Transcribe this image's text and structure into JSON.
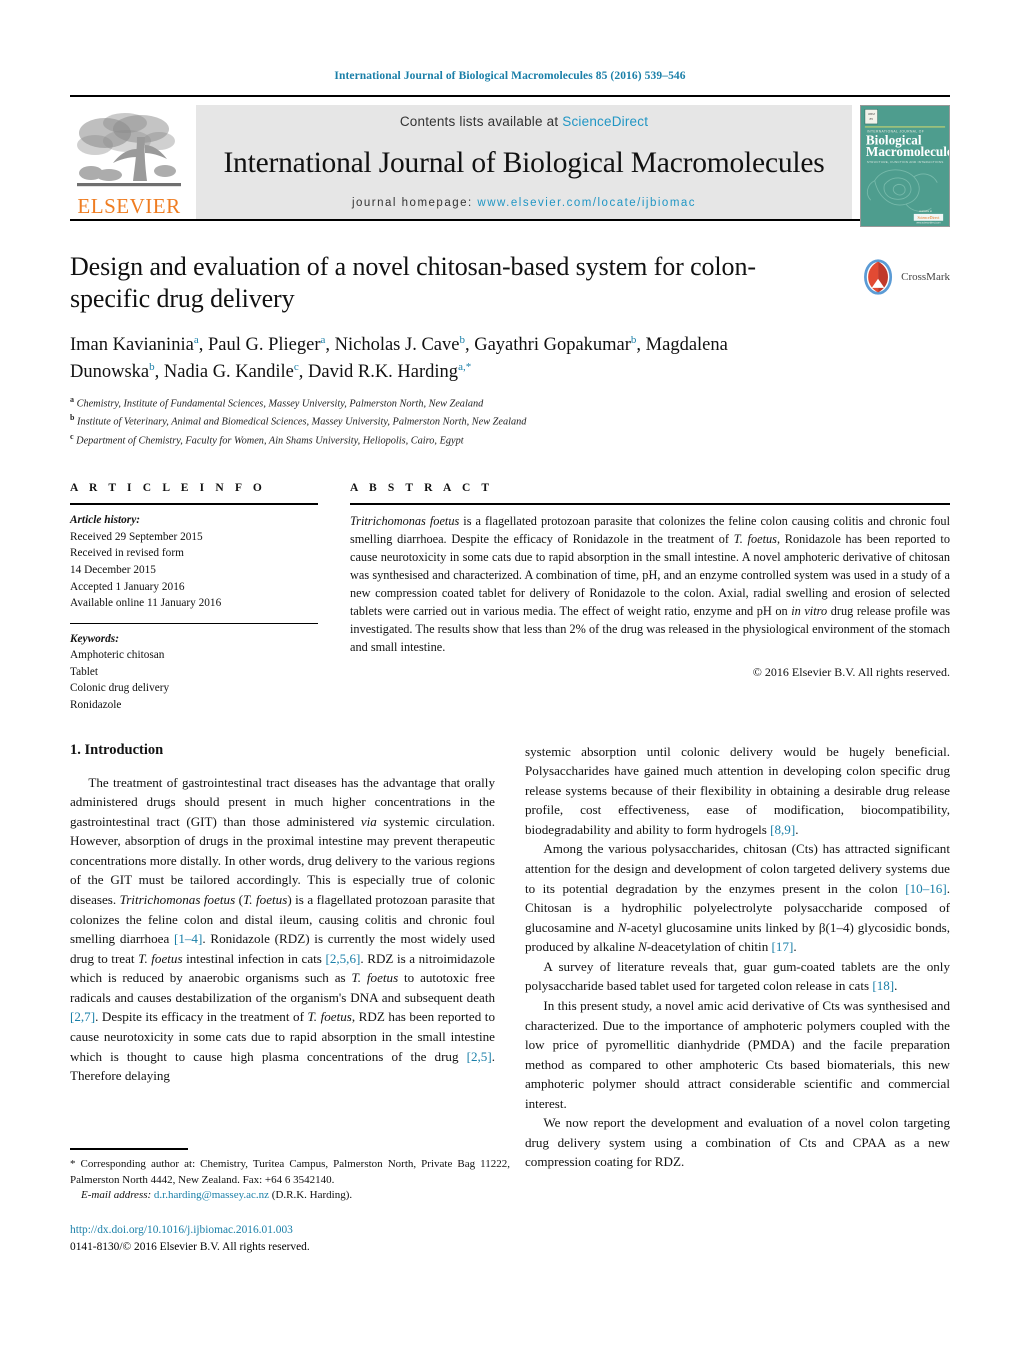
{
  "running_head": "International Journal of Biological Macromolecules 85 (2016) 539–546",
  "masthead": {
    "contents_prefix": "Contents lists available at",
    "sciencedirect": "ScienceDirect",
    "journal_name": "International Journal of Biological Macromolecules",
    "homepage_label": "journal homepage:",
    "homepage_url": "www.elsevier.com/locate/ijbiomac",
    "publisher": "ELSEVIER",
    "cover": {
      "top_line": "INTERNATIONAL JOURNAL OF",
      "title_line_1": "Biological",
      "title_line_2": "Macromolecules",
      "subtitle": "STRUCTURE, FUNCTION AND INTERACTIONS",
      "footer": "ScienceDirect",
      "footer_sub": "www.sciencedirect.com",
      "bg_color": "#4a9c8c"
    },
    "accent_link_color": "#2196c4",
    "elsevier_orange": "#ef7d22"
  },
  "article": {
    "title": "Design and evaluation of a novel chitosan-based system for colon-specific drug delivery",
    "crossmark_label": "CrossMark",
    "authors_html": "Iman Kavianinia<sup>a</sup>, Paul G. Plieger<sup>a</sup>, Nicholas J. Cave<sup>b</sup>, Gayathri Gopakumar<sup>b</sup>, Magdalena Dunowska<sup>b</sup>, Nadia G. Kandile<sup>c</sup>, David R.K. Harding<sup>a,*</sup>",
    "affiliations": [
      {
        "marker": "a",
        "text": "Chemistry, Institute of Fundamental Sciences, Massey University, Palmerston North, New Zealand"
      },
      {
        "marker": "b",
        "text": "Institute of Veterinary, Animal and Biomedical Sciences, Massey University, Palmerston North, New Zealand"
      },
      {
        "marker": "c",
        "text": "Department of Chemistry, Faculty for Women, Ain Shams University, Heliopolis, Cairo, Egypt"
      }
    ]
  },
  "article_info": {
    "heading": "A R T I C L E   I N F O",
    "history_label": "Article history:",
    "history": [
      "Received 29 September 2015",
      "Received in revised form",
      "14 December 2015",
      "Accepted 1 January 2016",
      "Available online 11 January 2016"
    ],
    "keywords_label": "Keywords:",
    "keywords": [
      "Amphoteric chitosan",
      "Tablet",
      "Colonic drug delivery",
      "Ronidazole"
    ]
  },
  "abstract": {
    "heading": "A B S T R A C T",
    "text_html": "<i>Tritrichomonas foetus</i> is a flagellated protozoan parasite that colonizes the feline colon causing colitis and chronic foul smelling diarrhoea. Despite the efficacy of Ronidazole in the treatment of <i>T. foetus</i>, Ronidazole has been reported to cause neurotoxicity in some cats due to rapid absorption in the small intestine. A novel amphoteric derivative of chitosan was synthesised and characterized. A combination of time, pH, and an enzyme controlled system was used in a study of a new compression coated tablet for delivery of Ronidazole to the colon. Axial, radial swelling and erosion of selected tablets were carried out in various media. The effect of weight ratio, enzyme and pH on <i>in vitro</i> drug release profile was investigated. The results show that less than 2% of the drug was released in the physiological environment of the stomach and small intestine.",
    "copyright": "© 2016 Elsevier B.V. All rights reserved."
  },
  "introduction": {
    "heading": "1.  Introduction",
    "left_paragraphs_html": [
      "The treatment of gastrointestinal tract diseases has the advantage that orally administered drugs should present in much higher concentrations in the gastrointestinal tract (GIT) than those administered <i>via</i> systemic circulation. However, absorption of drugs in the proximal intestine may prevent therapeutic concentrations more distally. In other words, drug delivery to the various regions of the GIT must be tailored accordingly. This is especially true of colonic diseases. <i>Tritrichomonas foetus</i> (<i>T. foetus</i>) is a flagellated protozoan parasite that colonizes the feline colon and distal ileum, causing colitis and chronic foul smelling diarrhoea <span class=\"ref\">[1–4]</span>. Ronidazole (RDZ) is currently the most widely used drug to treat <i>T. foetus</i> intestinal infection in cats <span class=\"ref\">[2,5,6]</span>. RDZ is a nitroimidazole which is reduced by anaerobic organisms such as <i>T. foetus</i> to autotoxic free radicals and causes destabilization of the organism's DNA and subsequent death <span class=\"ref\">[2,7]</span>. Despite its efficacy in the treatment of <i>T. foetus</i>, RDZ has been reported to cause neurotoxicity in some cats due to rapid absorption in the small intestine which is thought to cause high plasma concentrations of the drug <span class=\"ref\">[2,5]</span>. Therefore delaying"
    ],
    "right_paragraphs_html": [
      "systemic absorption until colonic delivery would be hugely beneficial. Polysaccharides have gained much attention in developing colon specific drug release systems because of their flexibility in obtaining a desirable drug release profile, cost effectiveness, ease of modification, biocompatibility, biodegradability and ability to form hydrogels <span class=\"ref\">[8,9]</span>.",
      "Among the various polysaccharides, chitosan (Cts) has attracted significant attention for the design and development of colon targeted delivery systems due to its potential degradation by the enzymes present in the colon <span class=\"ref\">[10–16]</span>. Chitosan is a hydrophilic polyelectrolyte polysaccharide composed of glucosamine and <i>N</i>-acetyl glucosamine units linked by β(1–4) glycosidic bonds, produced by alkaline <i>N</i>-deacetylation of chitin <span class=\"ref\">[17]</span>.",
      "A survey of literature reveals that, guar gum-coated tablets are the only polysaccharide based tablet used for targeted colon release in cats <span class=\"ref\">[18]</span>.",
      "In this present study, a novel amic acid derivative of Cts was synthesised and characterized. Due to the importance of amphoteric polymers coupled with the low price of pyromellitic dianhydride (PMDA) and the facile preparation method as compared to other amphoteric Cts based biomaterials, this new amphoteric polymer should attract considerable scientific and commercial interest.",
      "We now report the development and evaluation of a novel colon targeting drug delivery system using a combination of Cts and CPAA as a new compression coating for RDZ."
    ]
  },
  "footer": {
    "corresponding_html": "* Corresponding author at: Chemistry, Turitea Campus, Palmerston North, Private Bag 11222, Palmerston North 4442, New Zealand. Fax: +64 6 3542140.",
    "email_label": "E-mail address:",
    "email": "d.r.harding@massey.ac.nz",
    "email_owner": "(D.R.K. Harding).",
    "doi": "http://dx.doi.org/10.1016/j.ijbiomac.2016.01.003",
    "issn_line": "0141-8130/© 2016 Elsevier B.V. All rights reserved."
  }
}
